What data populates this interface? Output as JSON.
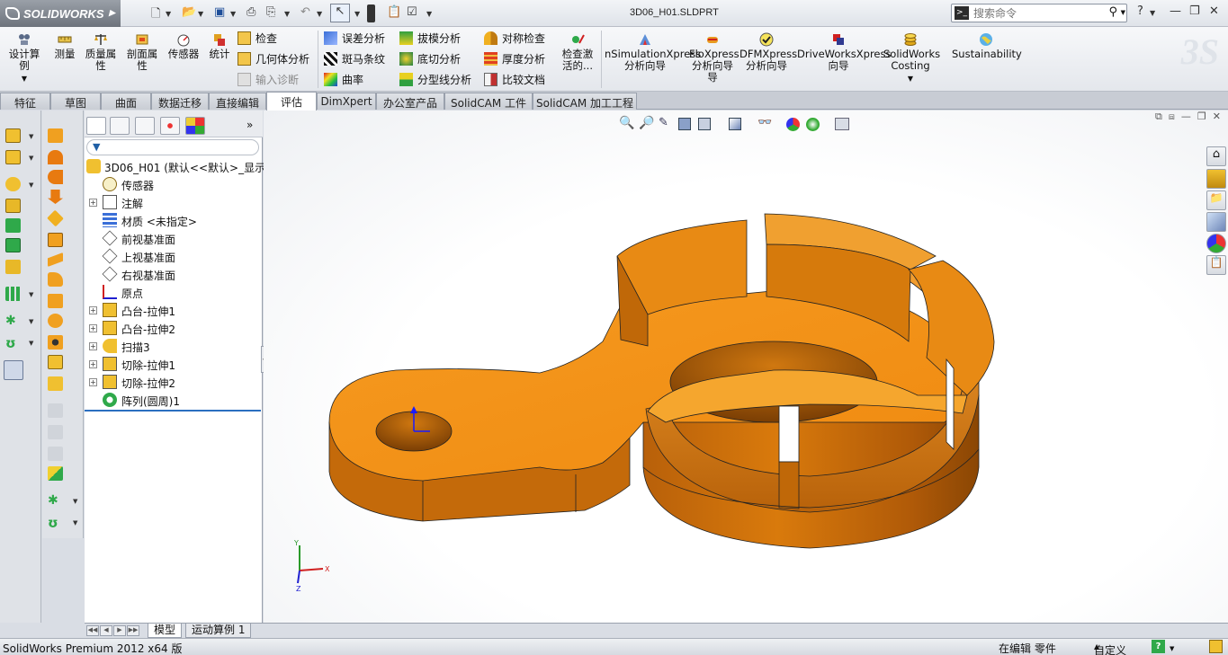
{
  "app": {
    "logo_text": "SOLIDWORKS",
    "filename": "3D06_H01.SLDPRT",
    "search_placeholder": "搜索命令",
    "help": "?"
  },
  "command_manager": {
    "big_buttons": [
      {
        "label": "设计算例"
      },
      {
        "label": "测量"
      },
      {
        "label": "质量属性"
      },
      {
        "label": "剖面属性"
      },
      {
        "label": "传感器"
      },
      {
        "label": "统计"
      }
    ],
    "check_group": [
      {
        "label": "检查",
        "enabled": true
      },
      {
        "label": "几何体分析",
        "enabled": true
      },
      {
        "label": "输入诊断",
        "enabled": false
      }
    ],
    "analysis_group_1": [
      {
        "label": "误差分析"
      },
      {
        "label": "斑马条纹"
      },
      {
        "label": "曲率"
      }
    ],
    "analysis_group_2": [
      {
        "label": "拔模分析"
      },
      {
        "label": "底切分析"
      },
      {
        "label": "分型线分析"
      }
    ],
    "analysis_group_3": [
      {
        "label": "对称检查"
      },
      {
        "label": "厚度分析"
      },
      {
        "label": "比较文档"
      }
    ],
    "check_active": "检查激活的...",
    "wizards": [
      {
        "line1": "nSimulationXpress",
        "line2": "分析向导"
      },
      {
        "line1": "FloXpress",
        "line2": "分析向导"
      },
      {
        "line1": "DFMXpress",
        "line2": "分析向导"
      },
      {
        "line1": "DriveWorksXpress",
        "line2": "向导"
      },
      {
        "line1": "SolidWorks",
        "line2": "Costing"
      },
      {
        "line1": "Sustainability",
        "line2": ""
      }
    ]
  },
  "tabs": [
    {
      "label": "特征"
    },
    {
      "label": "草图"
    },
    {
      "label": "曲面"
    },
    {
      "label": "数据迁移"
    },
    {
      "label": "直接编辑"
    },
    {
      "label": "评估",
      "active": true
    },
    {
      "label": "DimXpert"
    },
    {
      "label": "办公室产品"
    },
    {
      "label": "SolidCAM 工件"
    },
    {
      "label": "SolidCAM 加工工程"
    }
  ],
  "feature_tree": {
    "root": "3D06_H01  (默认<<默认>_显示",
    "items": [
      {
        "label": "传感器",
        "expandable": false,
        "icon": "sensor-icon"
      },
      {
        "label": "注解",
        "expandable": true,
        "icon": "annotation-icon"
      },
      {
        "label": "材质 <未指定>",
        "expandable": false,
        "icon": "material-icon"
      },
      {
        "label": "前视基准面",
        "expandable": false,
        "icon": "plane-icon"
      },
      {
        "label": "上视基准面",
        "expandable": false,
        "icon": "plane-icon"
      },
      {
        "label": "右视基准面",
        "expandable": false,
        "icon": "plane-icon"
      },
      {
        "label": "原点",
        "expandable": false,
        "icon": "origin-icon"
      },
      {
        "label": "凸台-拉伸1",
        "expandable": true,
        "icon": "boss-extrude-icon"
      },
      {
        "label": "凸台-拉伸2",
        "expandable": true,
        "icon": "boss-extrude-icon"
      },
      {
        "label": "扫描3",
        "expandable": true,
        "icon": "sweep-icon"
      },
      {
        "label": "切除-拉伸1",
        "expandable": true,
        "icon": "cut-extrude-icon"
      },
      {
        "label": "切除-拉伸2",
        "expandable": true,
        "icon": "cut-extrude-icon"
      },
      {
        "label": "阵列(圆周)1",
        "expandable": false,
        "icon": "circular-pattern-icon"
      }
    ]
  },
  "bottom_tabs": [
    {
      "label": "模型",
      "active": true
    },
    {
      "label": "运动算例 1",
      "active": false
    }
  ],
  "status": {
    "version": "SolidWorks Premium 2012 x64 版",
    "editing": "在编辑 零件",
    "units": "自定义"
  },
  "triad": {
    "x": "X",
    "y": "Y",
    "z": "Z"
  },
  "colors": {
    "part_orange": "#f08a10",
    "part_shadow": "#9a4f05",
    "tab_active": "#ffffff",
    "tree_accent": "#2b6fc0"
  }
}
